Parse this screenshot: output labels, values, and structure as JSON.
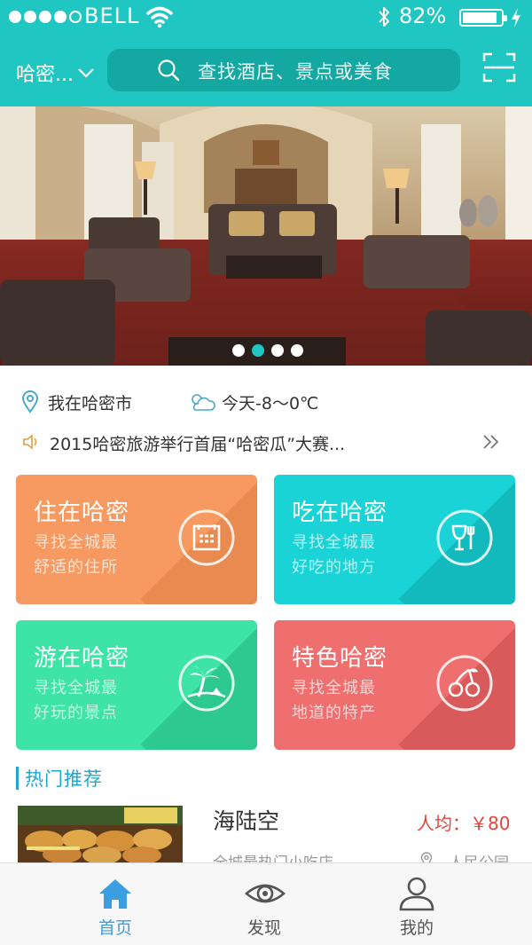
{
  "status_bar": {
    "carrier": "BELL",
    "battery_percent": "82%",
    "signal_bars_filled": 4,
    "signal_bars_total": 5
  },
  "header": {
    "city": "哈密...",
    "search_placeholder": "查找酒店、景点或美食"
  },
  "banner": {
    "page_count": 4,
    "active_page": 2
  },
  "info": {
    "location": "我在哈密市",
    "weather": "今天-8～0℃",
    "news": "2015哈密旅游举行首届“哈密瓜”大赛..."
  },
  "tiles": [
    {
      "title": "住在哈密",
      "line1": "寻找全城最",
      "line2": "舒适的住所",
      "color": "#f79a62",
      "icon": "hotel-icon"
    },
    {
      "title": "吃在哈密",
      "line1": "寻找全城最",
      "line2": "好吃的地方",
      "color": "#19d3d6",
      "icon": "dining-icon"
    },
    {
      "title": "游在哈密",
      "line1": "寻找全城最",
      "line2": "好玩的景点",
      "color": "#3ee4a6",
      "icon": "palm-tree-icon"
    },
    {
      "title": "特色哈密",
      "line1": "寻找全城最",
      "line2": "地道的特产",
      "color": "#ef6e6e",
      "icon": "cherry-icon"
    }
  ],
  "hot": {
    "section_title": "热门推荐",
    "items": [
      {
        "name": "海陆空",
        "price": "人均：￥80",
        "desc": "全城最热门小吃店",
        "area": "人民公园"
      }
    ]
  },
  "tabbar": {
    "items": [
      {
        "label": "首页",
        "icon": "home-icon",
        "active": true
      },
      {
        "label": "发现",
        "icon": "eye-icon",
        "active": false
      },
      {
        "label": "我的",
        "icon": "user-icon",
        "active": false
      }
    ],
    "active_color": "#3a9ee0",
    "inactive_color": "#555555"
  },
  "colors": {
    "brand": "#1fc6c2",
    "search_bg": "#14a8a3",
    "hot_accent": "#1fa6cf",
    "price": "#e2453b"
  }
}
